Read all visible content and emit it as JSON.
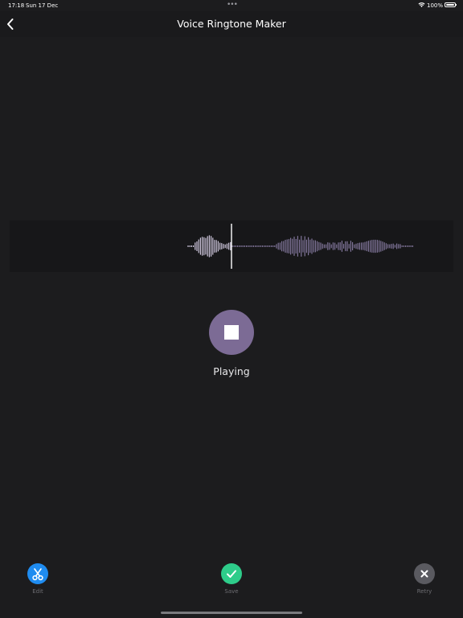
{
  "status_bar": {
    "time": "17:18",
    "date": "Sun 17 Dec",
    "battery": "100%",
    "icons": [
      "wifi-icon",
      "battery-icon"
    ]
  },
  "nav": {
    "title": "Voice Ringtone Maker",
    "back_icon": "chevron-left-icon"
  },
  "player": {
    "status": "Playing",
    "button_icon": "stop-icon",
    "button_color": "#7c6b95"
  },
  "waveform": {
    "played_color": "#e0d8f0",
    "remaining_color": "#8a7ea6",
    "playhead_color": "#ffffff"
  },
  "toolbar": {
    "edit": {
      "label": "Edit",
      "icon": "scissors-icon",
      "color": "#1f8cf0"
    },
    "save": {
      "label": "Save",
      "icon": "checkmark-icon",
      "color": "#2ecc8a"
    },
    "retry": {
      "label": "Retry",
      "icon": "close-icon",
      "color": "#5a5a60"
    }
  }
}
